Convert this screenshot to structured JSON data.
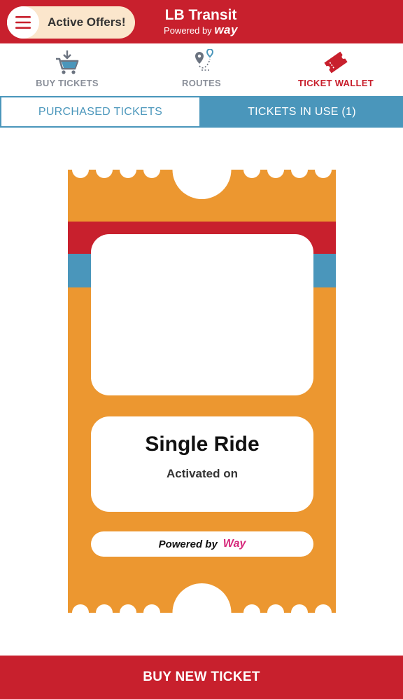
{
  "header": {
    "offers_label": "Active Offers!",
    "app_title": "LB Transit",
    "powered_by": "Powered by",
    "powered_brand": "way"
  },
  "nav": {
    "items": [
      {
        "label": "BUY TICKETS",
        "icon": "cart-download-icon"
      },
      {
        "label": "ROUTES",
        "icon": "route-map-pin-icon"
      },
      {
        "label": "TICKET WALLET",
        "icon": "ticket-icon",
        "active": true
      }
    ]
  },
  "tabs": {
    "purchased": "PURCHASED TICKETS",
    "in_use": "TICKETS IN USE (1)"
  },
  "ticket": {
    "name": "Single Ride",
    "activated_label": "Activated on",
    "powered_by": "Powered by",
    "powered_brand": "Way"
  },
  "footer": {
    "buy_button": "BUY NEW TICKET"
  },
  "colors": {
    "brand_red": "#c8202d",
    "tab_blue": "#4a96bb",
    "ticket_orange": "#ec9730",
    "stripe_red": "#c8202d",
    "stripe_blue": "#4a96bb",
    "way_pink": "#d6287a"
  }
}
